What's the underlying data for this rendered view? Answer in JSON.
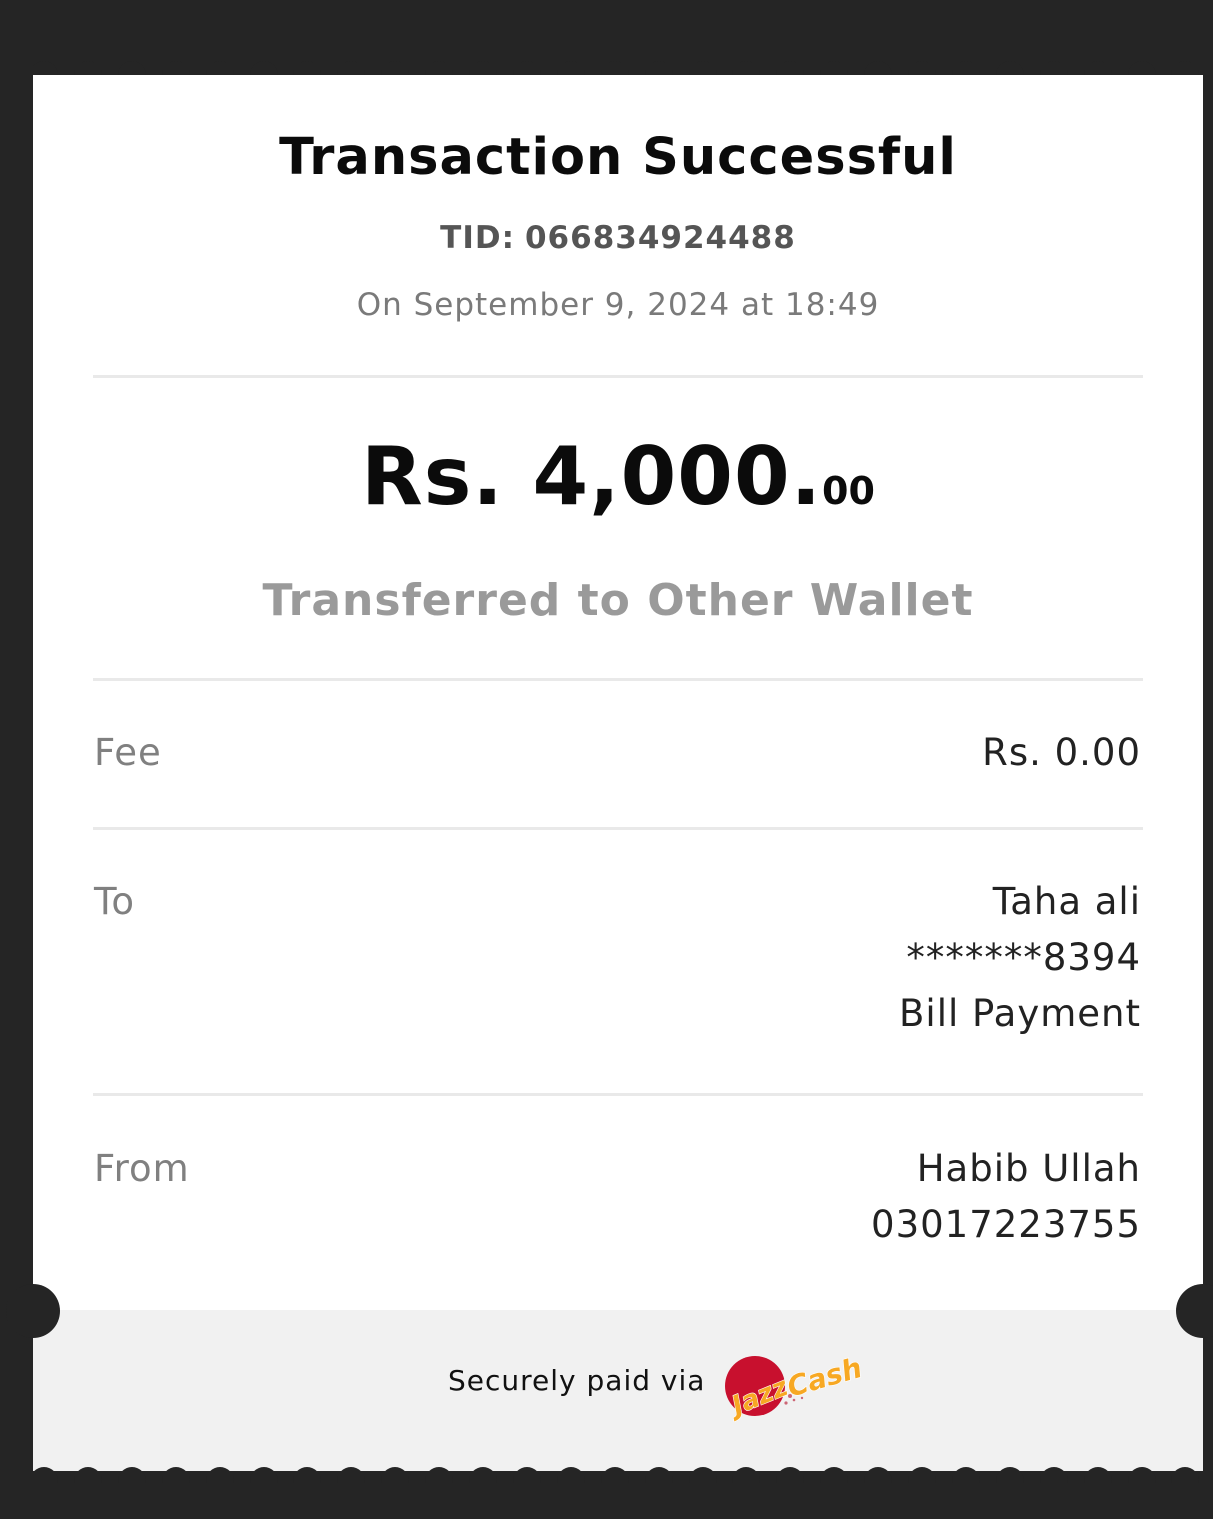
{
  "receipt": {
    "title": "Transaction Successful",
    "tid_label": "TID:",
    "tid_value": "066834924488",
    "datetime": "On September 9, 2024 at 18:49",
    "amount_main": "Rs. 4,000.",
    "amount_cents": "00",
    "transfer_type": "Transferred to Other Wallet"
  },
  "details": {
    "fee": {
      "label": "Fee",
      "value": "Rs. 0.00"
    },
    "to": {
      "label": "To",
      "name": "Taha ali",
      "account": "*******8394",
      "purpose": "Bill Payment"
    },
    "from": {
      "label": "From",
      "name": "Habib Ullah",
      "number": "03017223755"
    }
  },
  "footer": {
    "text": "Securely paid via",
    "logo": {
      "icon": "jazzcash-logo",
      "word1": "Jazz",
      "word2": "Cash",
      "colors": {
        "red": "#c8102e",
        "orange": "#f7a823"
      }
    }
  },
  "colors": {
    "background": "#252525",
    "card": "#ffffff",
    "footer": "#f1f1f1",
    "divider": "#e9e9e9"
  }
}
